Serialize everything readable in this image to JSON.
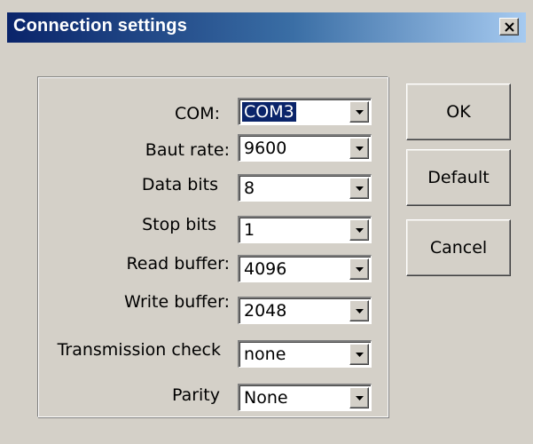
{
  "window": {
    "title": "Connection settings",
    "close_icon": "close-icon"
  },
  "colors": {
    "title_gradient_start": "#0a246a",
    "title_gradient_end": "#a6caf0",
    "dialog_face": "#d4d0c8",
    "selection": "#0a246a"
  },
  "fields": [
    {
      "label": "COM:",
      "value": "COM3",
      "selected": true
    },
    {
      "label": "Baut rate:",
      "value": "9600"
    },
    {
      "label": "Data bits",
      "value": "8"
    },
    {
      "label": "Stop bits",
      "value": "1"
    },
    {
      "label": "Read buffer:",
      "value": "4096"
    },
    {
      "label": "Write buffer:",
      "value": "2048"
    },
    {
      "label": "Transmission check",
      "value": "none"
    },
    {
      "label": "Parity",
      "value": "None"
    }
  ],
  "buttons": {
    "ok": "OK",
    "default": "Default",
    "cancel": "Cancel"
  }
}
